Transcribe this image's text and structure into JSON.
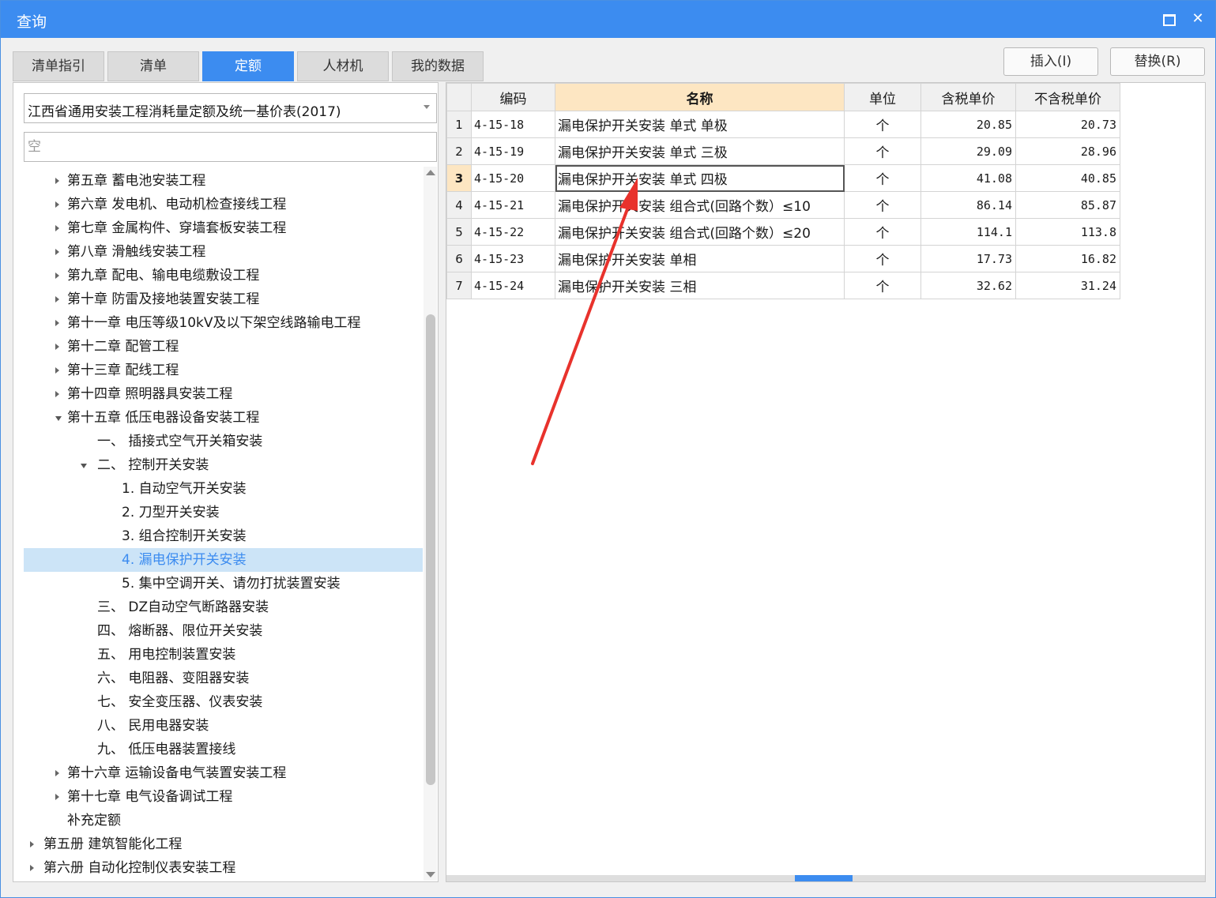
{
  "window": {
    "title": "查询"
  },
  "tabs": [
    {
      "label": "清单指引"
    },
    {
      "label": "清单"
    },
    {
      "label": "定额"
    },
    {
      "label": "人材机"
    },
    {
      "label": "我的数据"
    }
  ],
  "active_tab": "定额",
  "actions": {
    "insert": "插入(I)",
    "replace": "替换(R)"
  },
  "library": {
    "selected": "江西省通用安装工程消耗量定额及统一基价表(2017)"
  },
  "search": {
    "placeholder": "空",
    "value": ""
  },
  "tree": [
    {
      "label": "第五章 蓄电池安装工程",
      "level": 1,
      "state": "collapsed"
    },
    {
      "label": "第六章 发电机、电动机检查接线工程",
      "level": 1,
      "state": "collapsed"
    },
    {
      "label": "第七章 金属构件、穿墙套板安装工程",
      "level": 1,
      "state": "collapsed"
    },
    {
      "label": "第八章 滑触线安装工程",
      "level": 1,
      "state": "collapsed"
    },
    {
      "label": "第九章 配电、输电电缆敷设工程",
      "level": 1,
      "state": "collapsed"
    },
    {
      "label": "第十章 防雷及接地装置安装工程",
      "level": 1,
      "state": "collapsed"
    },
    {
      "label": "第十一章 电压等级10kV及以下架空线路输电工程",
      "level": 1,
      "state": "collapsed"
    },
    {
      "label": "第十二章 配管工程",
      "level": 1,
      "state": "collapsed"
    },
    {
      "label": "第十三章 配线工程",
      "level": 1,
      "state": "collapsed"
    },
    {
      "label": "第十四章 照明器具安装工程",
      "level": 1,
      "state": "collapsed"
    },
    {
      "label": "第十五章 低压电器设备安装工程",
      "level": 1,
      "state": "expanded"
    },
    {
      "label": "一、 插接式空气开关箱安装",
      "level": 2,
      "state": "leaf"
    },
    {
      "label": "二、 控制开关安装",
      "level": 2,
      "state": "expanded"
    },
    {
      "label": "1. 自动空气开关安装",
      "level": 3,
      "state": "leaf"
    },
    {
      "label": "2. 刀型开关安装",
      "level": 3,
      "state": "leaf"
    },
    {
      "label": "3. 组合控制开关安装",
      "level": 3,
      "state": "leaf"
    },
    {
      "label": "4. 漏电保护开关安装",
      "level": 3,
      "state": "leaf",
      "selected": true
    },
    {
      "label": "5. 集中空调开关、请勿打扰装置安装",
      "level": 3,
      "state": "leaf"
    },
    {
      "label": "三、 DZ自动空气断路器安装",
      "level": 2,
      "state": "leaf"
    },
    {
      "label": "四、 熔断器、限位开关安装",
      "level": 2,
      "state": "leaf"
    },
    {
      "label": "五、 用电控制装置安装",
      "level": 2,
      "state": "leaf"
    },
    {
      "label": "六、 电阻器、变阻器安装",
      "level": 2,
      "state": "leaf"
    },
    {
      "label": "七、 安全变压器、仪表安装",
      "level": 2,
      "state": "leaf"
    },
    {
      "label": "八、 民用电器安装",
      "level": 2,
      "state": "leaf"
    },
    {
      "label": "九、 低压电器装置接线",
      "level": 2,
      "state": "leaf"
    },
    {
      "label": "第十六章 运输设备电气装置安装工程",
      "level": 1,
      "state": "collapsed"
    },
    {
      "label": "第十七章 电气设备调试工程",
      "level": 1,
      "state": "collapsed"
    },
    {
      "label": "补充定额",
      "level": 1,
      "state": "leaf"
    },
    {
      "label": "第五册 建筑智能化工程",
      "level": 0,
      "state": "collapsed"
    },
    {
      "label": "第六册 自动化控制仪表安装工程",
      "level": 0,
      "state": "collapsed"
    }
  ],
  "grid": {
    "columns": [
      "编码",
      "名称",
      "单位",
      "含税单价",
      "不含税单价"
    ],
    "sorted_column": "名称",
    "current_row": 3,
    "rows": [
      {
        "no": "1",
        "code": "4-15-18",
        "name": "漏电保护开关安装 单式 单极",
        "unit": "个",
        "tax_price": "20.85",
        "notax_price": "20.73"
      },
      {
        "no": "2",
        "code": "4-15-19",
        "name": "漏电保护开关安装 单式 三极",
        "unit": "个",
        "tax_price": "29.09",
        "notax_price": "28.96"
      },
      {
        "no": "3",
        "code": "4-15-20",
        "name": "漏电保护开关安装 单式 四极",
        "unit": "个",
        "tax_price": "41.08",
        "notax_price": "40.85"
      },
      {
        "no": "4",
        "code": "4-15-21",
        "name": "漏电保护开关安装 组合式(回路个数）≤10",
        "unit": "个",
        "tax_price": "86.14",
        "notax_price": "85.87"
      },
      {
        "no": "5",
        "code": "4-15-22",
        "name": "漏电保护开关安装 组合式(回路个数）≤20",
        "unit": "个",
        "tax_price": "114.1",
        "notax_price": "113.8"
      },
      {
        "no": "6",
        "code": "4-15-23",
        "name": "漏电保护开关安装 单相",
        "unit": "个",
        "tax_price": "17.73",
        "notax_price": "16.82"
      },
      {
        "no": "7",
        "code": "4-15-24",
        "name": "漏电保护开关安装 三相",
        "unit": "个",
        "tax_price": "32.62",
        "notax_price": "31.24"
      }
    ]
  },
  "colors": {
    "accent": "#3c8cf0",
    "header_highlight": "#fde6c2",
    "tree_selected_bg": "#cce4f7",
    "annotation_arrow": "#e8322c"
  },
  "icons": {
    "maximize": "maximize-icon",
    "close": "close-icon",
    "dropdown": "chevron-down-icon"
  }
}
